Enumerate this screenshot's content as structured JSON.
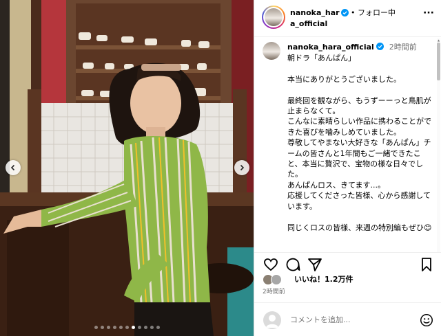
{
  "header": {
    "username": "nanoka_hara_official",
    "separator": "•",
    "follow_label": "フォロー中",
    "more_label": "···"
  },
  "caption": {
    "username": "nanoka_hara_official",
    "time": "2時間前",
    "lines": [
      "朝ドラ「あんぱん」",
      "",
      "本当にありがとうございました。",
      "",
      "最終回を観ながら、もうずーーっと鳥肌が止まらなくて。",
      "こんなに素晴らしい作品に携わることができた喜びを噛みしめていました。",
      "尊敬してやまない大好きな「あんぱん」チームの皆さんと1年間もご一緒できたこと、本当に贅沢で、宝物の様な日々でした。",
      "あんぱんロス、きてます...。",
      "応援してくださった皆様、心から感謝しています。",
      "",
      "同じくロスの皆様、来週の特別編もぜひ😊"
    ]
  },
  "likes": {
    "label": "いいね！1.2万件"
  },
  "posted_time": "2時間前",
  "comment": {
    "placeholder": "コメントを追加..."
  },
  "carousel": {
    "slide_count": 11,
    "active_index": 6
  },
  "colors": {
    "verified": "#0095f6",
    "muted": "#737373",
    "border": "#dbdbdb"
  },
  "icons": [
    "chevron-left-icon",
    "chevron-right-icon",
    "more-icon",
    "verified-icon",
    "heart-icon",
    "comment-icon",
    "share-icon",
    "bookmark-icon",
    "emoji-icon"
  ]
}
